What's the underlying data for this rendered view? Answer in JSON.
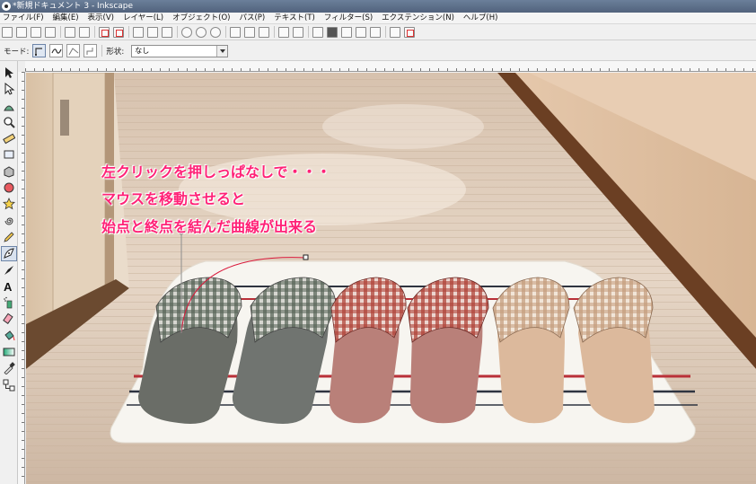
{
  "window": {
    "title": "*新規ドキュメント 3 - Inkscape"
  },
  "menubar": {
    "items": [
      "ファイル(F)",
      "編集(E)",
      "表示(V)",
      "レイヤー(L)",
      "オブジェクト(O)",
      "パス(P)",
      "テキスト(T)",
      "フィルター(S)",
      "エクステンション(N)",
      "ヘルプ(H)"
    ]
  },
  "toolcontrols": {
    "mode_label": "モード:",
    "shape_label": "形状:",
    "shape_value": "なし"
  },
  "canvas": {
    "annotations": [
      "左クリックを押しっぱなしで・・・",
      "マウスを移動させると",
      "始点と終点を結んだ曲線が出来る"
    ],
    "annotation_color": "#ff2277",
    "curve_color": "#d9183a"
  },
  "toolbox": {
    "tools": [
      "selector-tool-icon",
      "node-tool-icon",
      "tweak-tool-icon",
      "zoom-tool-icon",
      "measure-tool-icon",
      "rect-tool-icon",
      "3dbox-tool-icon",
      "ellipse-tool-icon",
      "star-tool-icon",
      "spiral-tool-icon",
      "pencil-tool-icon",
      "pen-tool-icon",
      "calligraphy-tool-icon",
      "text-tool-icon",
      "spray-tool-icon",
      "eraser-tool-icon",
      "bucket-tool-icon",
      "gradient-tool-icon",
      "dropper-tool-icon",
      "connector-tool-icon"
    ],
    "active_tool": "pen-tool-icon"
  }
}
